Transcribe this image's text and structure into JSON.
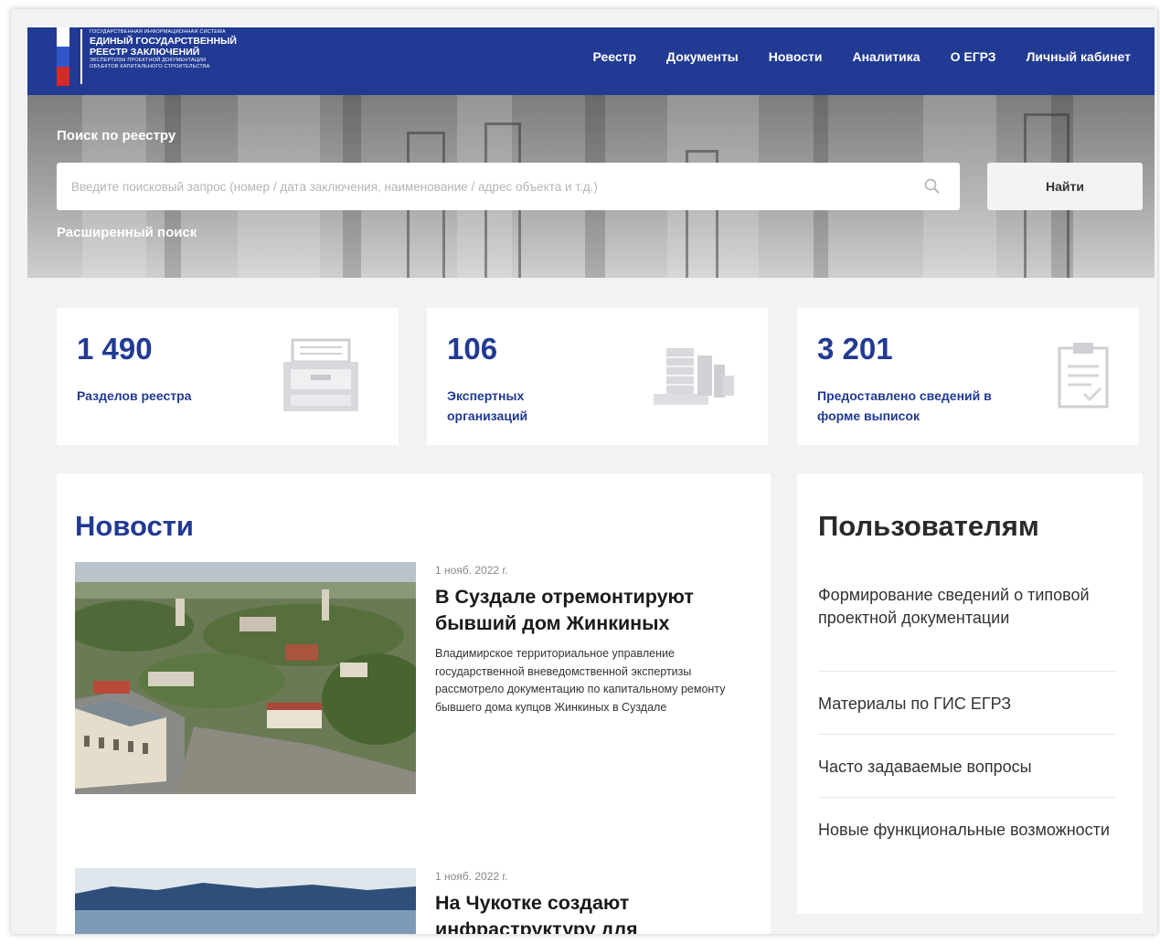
{
  "header": {
    "logo": {
      "line1": "Государственная информационная система",
      "line2": "Единый государственный",
      "line3": "реестр заключений",
      "line4": "экспертизы проектной документации",
      "line5": "объектов капитального строительства"
    },
    "nav": [
      "Реестр",
      "Документы",
      "Новости",
      "Аналитика",
      "О ЕГРЗ",
      "Личный кабинет"
    ],
    "flag_colors": [
      "#ffffff",
      "#2f57c9",
      "#d42a2a"
    ],
    "accent": "#213a93"
  },
  "hero": {
    "search_label": "Поиск по реестру",
    "search_placeholder": "Введите поисковый запрос (номер / дата заключения, наименование / адрес объекта и т.д.)",
    "search_icon": "search-icon",
    "find_button": "Найти",
    "advanced_search": "Расширенный поиск"
  },
  "stats": [
    {
      "value": "1 490",
      "label": "Разделов реестра",
      "icon": "filing-cabinet-icon"
    },
    {
      "value": "106",
      "label": "Экспертных организаций",
      "icon": "buildings-icon"
    },
    {
      "value": "3 201",
      "label": "Предоставлено сведений в форме выписок",
      "icon": "clipboard-icon"
    }
  ],
  "news": {
    "title": "Новости",
    "items": [
      {
        "date": "1 нояб. 2022 г.",
        "headline": "В Суздале отремонтируют бывший дом Жинкиных",
        "description": "Владимирское территориальное управление государственной вневедомственной экспертизы рассмотрело документацию по капитальному ремонту бывшего дома купцов Жинкиных в Суздале"
      },
      {
        "date": "1 нояб. 2022 г.",
        "headline": "На Чукотке создают инфраструктуру для"
      }
    ]
  },
  "users": {
    "title": "Пользователям",
    "links": [
      "Формирование сведений о типовой проектной документации",
      "Материалы по ГИС ЕГРЗ",
      "Часто задаваемые вопросы",
      "Новые функциональные возможности"
    ]
  }
}
